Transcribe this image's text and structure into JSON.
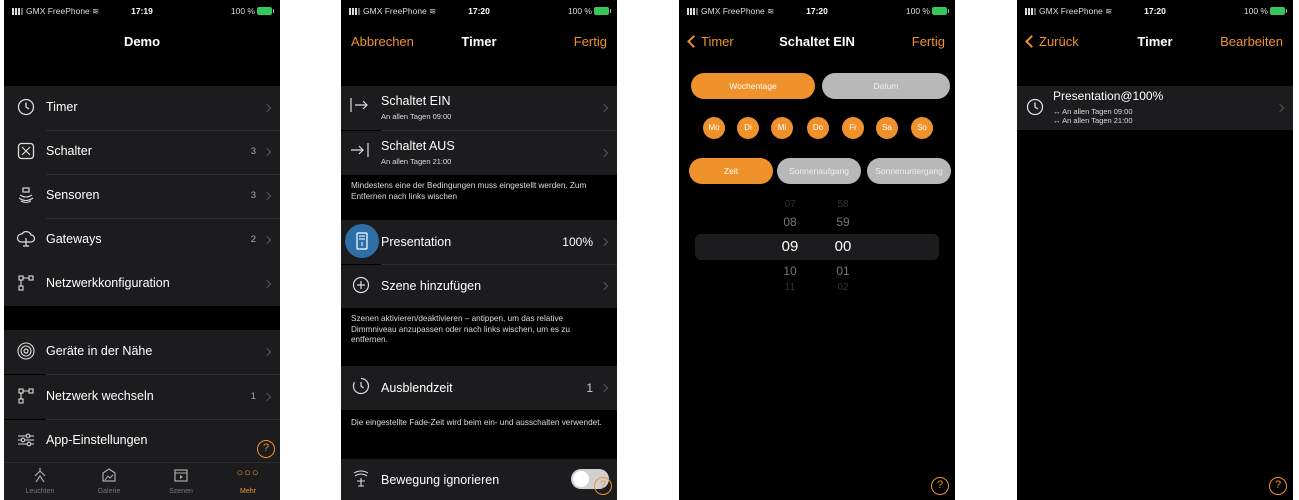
{
  "status": {
    "carrier": "GMX FreePhone",
    "battery": "100 %",
    "times": [
      "17:19",
      "17:20",
      "17:20",
      "17:20"
    ]
  },
  "screen1": {
    "title": "Demo",
    "items": [
      {
        "label": "Timer",
        "count": "",
        "icon": "clock-icon"
      },
      {
        "label": "Schalter",
        "count": "3",
        "icon": "switch-icon"
      },
      {
        "label": "Sensoren",
        "count": "3",
        "icon": "sensor-icon"
      },
      {
        "label": "Gateways",
        "count": "2",
        "icon": "gateway-icon"
      },
      {
        "label": "Netzwerkkonfiguration",
        "count": "",
        "icon": "network-icon"
      }
    ],
    "items2": [
      {
        "label": "Geräte in der Nähe",
        "count": "",
        "icon": "nearby-icon"
      },
      {
        "label": "Netzwerk wechseln",
        "count": "1",
        "icon": "network-switch-icon"
      },
      {
        "label": "App-Einstellungen",
        "count": "",
        "icon": "settings-sliders-icon"
      }
    ],
    "tabs": [
      {
        "label": "Leuchten",
        "icon": "lamp-icon"
      },
      {
        "label": "Galerie",
        "icon": "gallery-icon"
      },
      {
        "label": "Szenen",
        "icon": "scenes-icon"
      },
      {
        "label": "Mehr",
        "icon": "more-icon"
      }
    ]
  },
  "screen2": {
    "cancel": "Abbrechen",
    "title": "Timer",
    "done": "Fertig",
    "on_label": "Schaltet EIN",
    "on_sub": "An allen Tagen  09:00",
    "off_label": "Schaltet AUS",
    "off_sub": "An allen Tagen  21:00",
    "note1": "Mindestens eine der Bedingungen muss eingestellt werden. Zum Entfernen nach links wischen",
    "scene_label": "Presentation",
    "scene_value": "100%",
    "add_scene": "Szene hinzufügen",
    "note2": "Szenen aktivieren/deaktivieren – antippen, um das relative Dimmniveau anzupassen oder nach links wischen, um es zu entfernen.",
    "fade_label": "Ausblendzeit",
    "fade_value": "1",
    "note3": "Die eingestellte Fade-Zeit wird beim ein- und ausschalten verwendet.",
    "motion_label": "Bewegung ignorieren"
  },
  "screen3": {
    "back": "Timer",
    "title": "Schaltet EIN",
    "done": "Fertig",
    "mode_weekdays": "Wochentage",
    "mode_date": "Datum",
    "days": [
      "Mo",
      "Di",
      "Mi",
      "Do",
      "Fr",
      "Sa",
      "So"
    ],
    "time_mode": "Zeit",
    "sunrise": "Sonnenaufgang",
    "sunset": "Sonnenuntergang",
    "hours": [
      "07",
      "08",
      "09",
      "10",
      "11"
    ],
    "minutes": [
      "58",
      "59",
      "00",
      "01",
      "02"
    ]
  },
  "screen4": {
    "back": "Zurück",
    "title": "Timer",
    "edit": "Bearbeiten",
    "entry_title": "Presentation@100%",
    "entry_on": "↔ An allen Tagen 09:00",
    "entry_off": "↔ An allen Tagen 21:00"
  },
  "colors": {
    "accent": "#f0922c",
    "background": "#000000",
    "row": "#1c1c1e"
  }
}
